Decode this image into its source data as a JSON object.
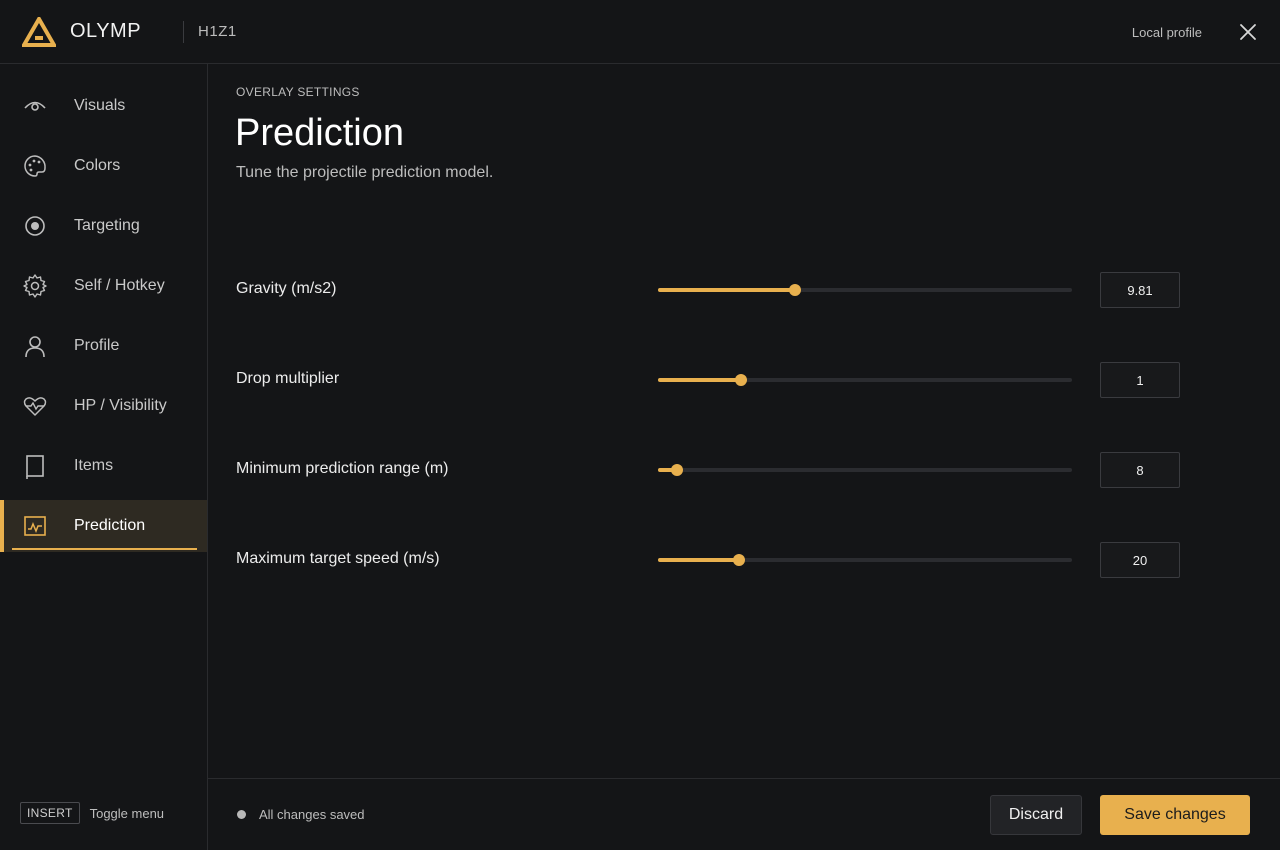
{
  "app": {
    "brand": "OLYMP",
    "game": "H1Z1",
    "profile_label": "Local profile",
    "accent_color": "#e8b04e"
  },
  "sidebar": {
    "items": [
      {
        "label": "Visuals",
        "icon": "eye-icon",
        "active": false
      },
      {
        "label": "Colors",
        "icon": "palette-icon",
        "active": false
      },
      {
        "label": "Targeting",
        "icon": "target-icon",
        "active": false
      },
      {
        "label": "Self / Hotkey",
        "icon": "gear-icon",
        "active": false
      },
      {
        "label": "Profile",
        "icon": "user-icon",
        "active": false
      },
      {
        "label": "HP / Visibility",
        "icon": "heart-pulse-icon",
        "active": false
      },
      {
        "label": "Items",
        "icon": "item-icon",
        "active": false
      },
      {
        "label": "Prediction",
        "icon": "chart-pulse-icon",
        "active": true
      }
    ],
    "footer": {
      "key": "INSERT",
      "label": "Toggle menu"
    }
  },
  "main": {
    "eyebrow": "OVERLAY SETTINGS",
    "title": "Prediction",
    "subtitle": "Tune the projectile prediction model.",
    "settings": [
      {
        "label": "Gravity (m/s2)",
        "value": "9.81",
        "fill_fraction": 0.33
      },
      {
        "label": "Drop multiplier",
        "value": "1",
        "fill_fraction": 0.2
      },
      {
        "label": "Minimum prediction range (m)",
        "value": "8",
        "fill_fraction": 0.045
      },
      {
        "label": "Maximum target speed (m/s)",
        "value": "20",
        "fill_fraction": 0.195
      }
    ]
  },
  "footer": {
    "status": "All changes saved",
    "discard_label": "Discard",
    "save_label": "Save changes"
  }
}
